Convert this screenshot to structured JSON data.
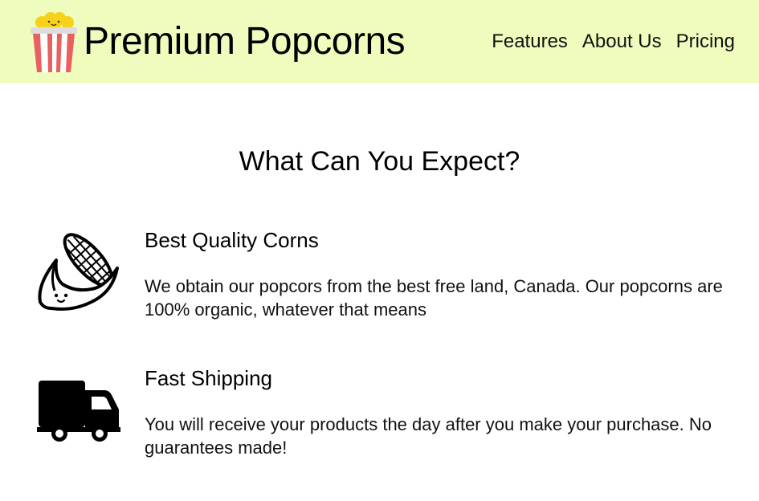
{
  "header": {
    "brand": "Premium Popcorns",
    "logo_icon": "popcorn-bucket-icon",
    "nav": [
      "Features",
      "About Us",
      "Pricing"
    ],
    "background": "#eefdbd"
  },
  "main": {
    "title": "What Can You Expect?",
    "features": [
      {
        "icon": "corn-icon",
        "title": "Best Quality Corns",
        "text": "We obtain our popcors from the best free land, Canada. Our popcorns are 100% organic, whatever that means"
      },
      {
        "icon": "truck-icon",
        "title": "Fast Shipping",
        "text": "You will receive your products the day after you make your purchase. No guarantees made!"
      }
    ]
  }
}
